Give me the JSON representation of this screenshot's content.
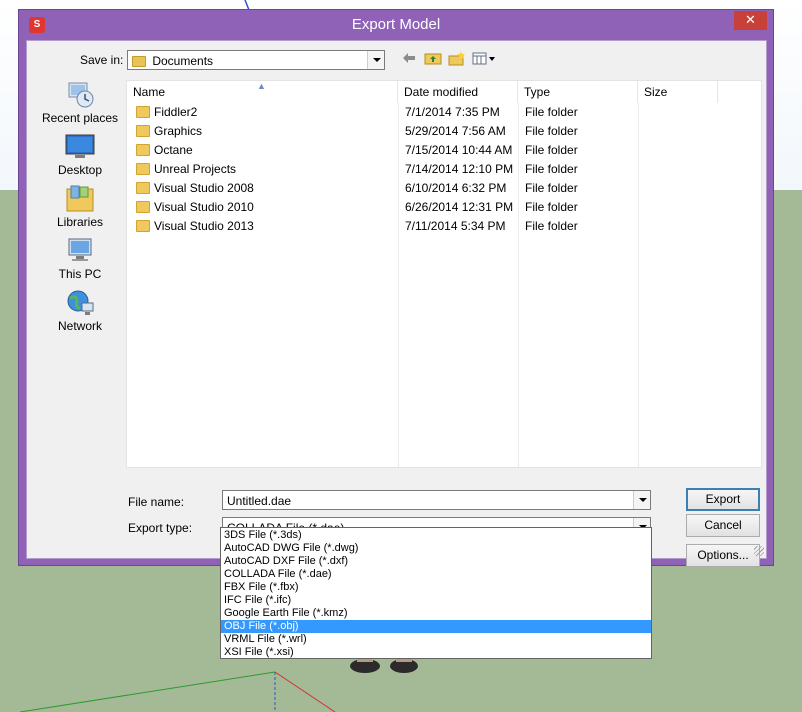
{
  "window": {
    "title": "Export Model",
    "app_icon": "sketchup-icon",
    "close_glyph": "✕"
  },
  "save_in": {
    "label": "Save in:",
    "value": "Documents"
  },
  "toolbar": {
    "back_icon": "back-arrow-icon",
    "up_icon": "up-folder-icon",
    "new_folder_icon": "new-folder-icon",
    "view_icon": "view-menu-icon"
  },
  "places": [
    {
      "label": "Recent places",
      "icon": "recent-places-icon"
    },
    {
      "label": "Desktop",
      "icon": "desktop-icon"
    },
    {
      "label": "Libraries",
      "icon": "libraries-icon"
    },
    {
      "label": "This PC",
      "icon": "this-pc-icon"
    },
    {
      "label": "Network",
      "icon": "network-icon"
    }
  ],
  "file_list": {
    "columns": [
      "Name",
      "Date modified",
      "Type",
      "Size"
    ],
    "rows": [
      {
        "name": "Fiddler2",
        "date": "7/1/2014 7:35 PM",
        "type": "File folder",
        "size": ""
      },
      {
        "name": "Graphics",
        "date": "5/29/2014 7:56 AM",
        "type": "File folder",
        "size": ""
      },
      {
        "name": "Octane",
        "date": "7/15/2014 10:44 AM",
        "type": "File folder",
        "size": ""
      },
      {
        "name": "Unreal Projects",
        "date": "7/14/2014 12:10 PM",
        "type": "File folder",
        "size": ""
      },
      {
        "name": "Visual Studio 2008",
        "date": "6/10/2014 6:32 PM",
        "type": "File folder",
        "size": ""
      },
      {
        "name": "Visual Studio 2010",
        "date": "6/26/2014 12:31 PM",
        "type": "File folder",
        "size": ""
      },
      {
        "name": "Visual Studio 2013",
        "date": "7/11/2014 5:34 PM",
        "type": "File folder",
        "size": ""
      }
    ]
  },
  "file_name": {
    "label": "File name:",
    "value": "Untitled.dae"
  },
  "export_type": {
    "label": "Export type:",
    "value": "COLLADA File (*.dae)",
    "options": [
      "3DS File (*.3ds)",
      "AutoCAD DWG File (*.dwg)",
      "AutoCAD DXF File (*.dxf)",
      "COLLADA File (*.dae)",
      "FBX File (*.fbx)",
      "IFC File (*.ifc)",
      "Google Earth File (*.kmz)",
      "OBJ File (*.obj)",
      "VRML File (*.wrl)",
      "XSI File (*.xsi)"
    ],
    "highlighted": "OBJ File (*.obj)"
  },
  "buttons": {
    "export": "Export",
    "cancel": "Cancel",
    "options": "Options..."
  },
  "colors": {
    "title_bar": "#8f62b8",
    "close_button": "#c7413a",
    "selection": "#3399ff",
    "ground": "#a4b996"
  }
}
